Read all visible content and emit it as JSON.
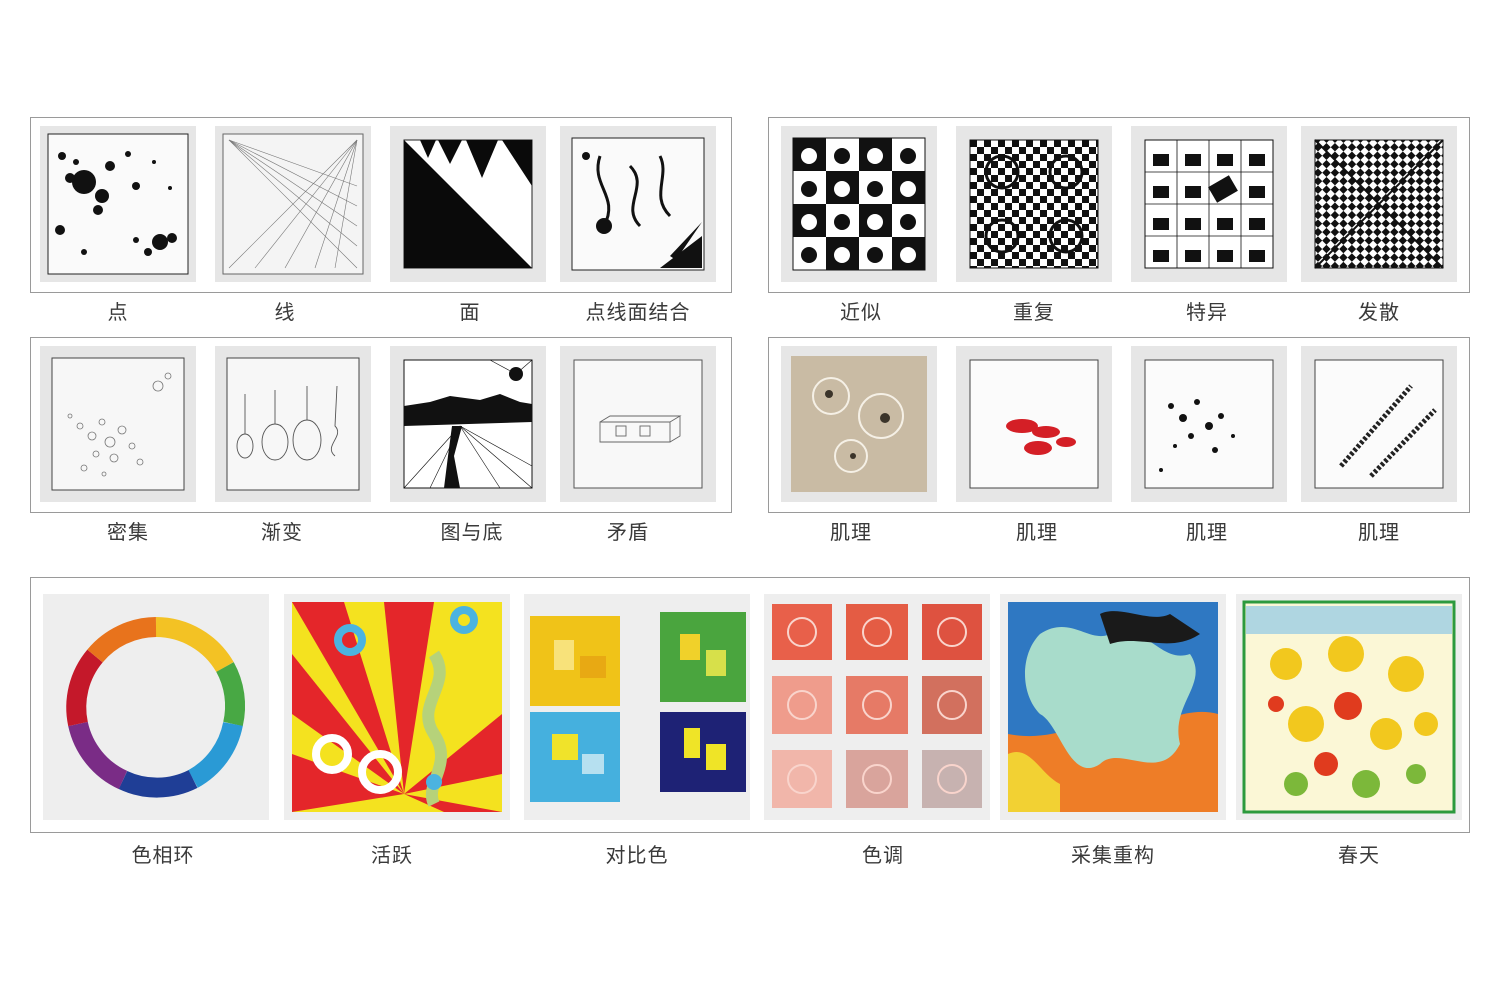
{
  "row1_left": [
    "点",
    "线",
    "面",
    "点线面结合"
  ],
  "row1_right": [
    "近似",
    "重复",
    "特异",
    "发散"
  ],
  "row2_left": [
    "密集",
    "渐变",
    "图与底",
    "矛盾"
  ],
  "row2_right": [
    "肌理",
    "肌理",
    "肌理",
    "肌理"
  ],
  "row3": [
    "色相环",
    "活跃",
    "对比色",
    "色调",
    "采集重构",
    "春天"
  ]
}
